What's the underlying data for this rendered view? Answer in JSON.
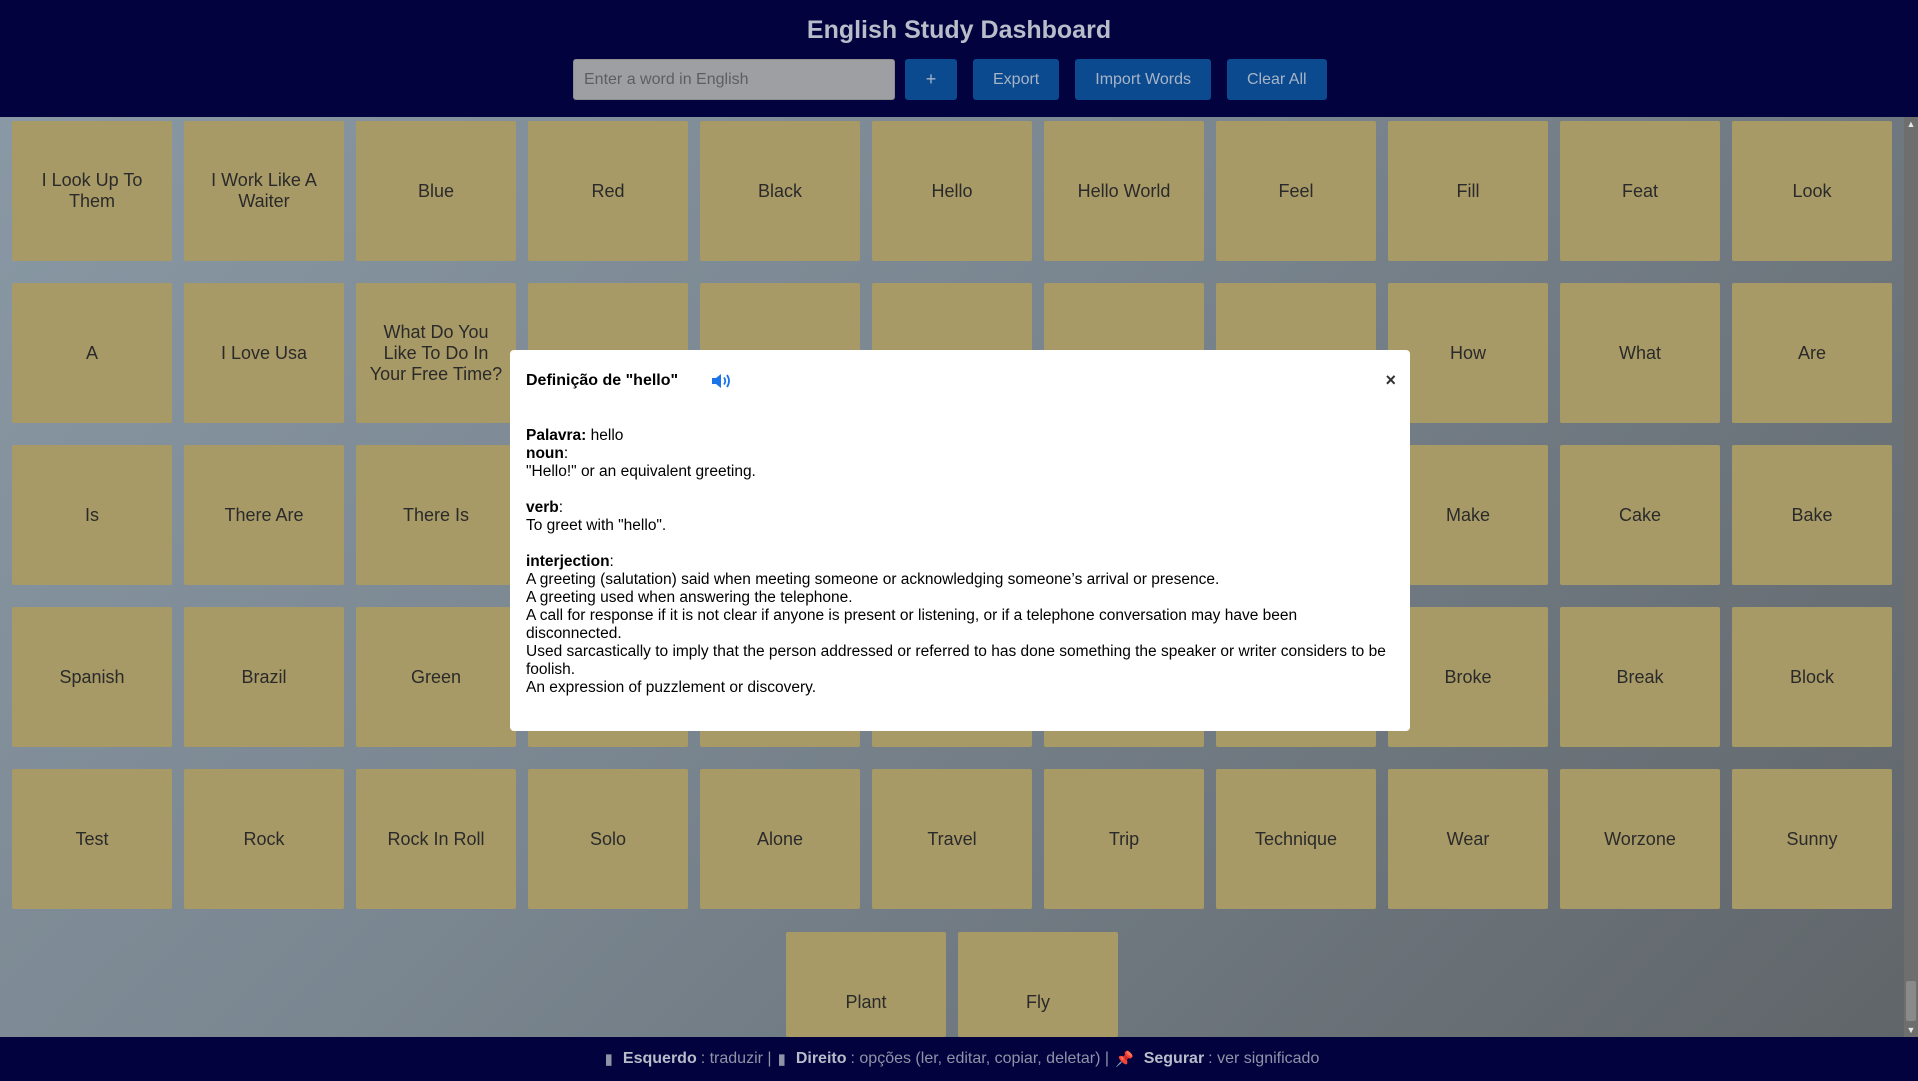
{
  "header": {
    "title": "English Study Dashboard",
    "input_placeholder": "Enter a word in English",
    "add_label": "+",
    "export_label": "Export",
    "import_label": "Import Words",
    "clear_label": "Clear All"
  },
  "words": [
    "I Look Up To Them",
    "I Work Like A Waiter",
    "Blue",
    "Red",
    "Black",
    "Hello",
    "Hello World",
    "Feel",
    "Fill",
    "Feat",
    "Look",
    "A",
    "I Love Usa",
    "What Do You Like To Do In Your Free Time?",
    "",
    "",
    "",
    "",
    "",
    "How",
    "What",
    "Are",
    "Is",
    "There Are",
    "There Is",
    "",
    "",
    "",
    "",
    "",
    "Make",
    "Cake",
    "Bake",
    "Spanish",
    "Brazil",
    "Green",
    "",
    "",
    "",
    "",
    "",
    "Broke",
    "Break",
    "Block",
    "Test",
    "Rock",
    "Rock In Roll",
    "Solo",
    "Alone",
    "Travel",
    "Trip",
    "Technique",
    "Wear",
    "Worzone",
    "Sunny",
    "Plant",
    "Fly"
  ],
  "modal": {
    "title": "Definição de \"hello\"",
    "word_label": "Palavra:",
    "word": "hello",
    "sections": [
      {
        "pos": "noun",
        "defs": [
          "\"Hello!\" or an equivalent greeting."
        ]
      },
      {
        "pos": "verb",
        "defs": [
          "To greet with \"hello\"."
        ]
      },
      {
        "pos": "interjection",
        "defs": [
          "A greeting (salutation) said when meeting someone or acknowledging someone’s arrival or presence.",
          "A greeting used when answering the telephone.",
          "A call for response if it is not clear if anyone is present or listening, or if a telephone conversation may have been disconnected.",
          "Used sarcastically to imply that the person addressed or referred to has done something the speaker or writer considers to be foolish.",
          "An expression of puzzlement or discovery."
        ]
      }
    ],
    "close_label": "×"
  },
  "footer": {
    "left_label": "Esquerdo",
    "left_desc": ": traduzir |",
    "right_label": "Direito",
    "right_desc": ": opções (ler, editar, copiar, deletar) |",
    "hold_label": "Segurar",
    "hold_desc": ": ver significado"
  },
  "colors": {
    "header_bg": "#02023f",
    "card_bg": "#a89a66",
    "button_bg": "#0b4a8f",
    "speaker_icon": "#1a73e8"
  }
}
